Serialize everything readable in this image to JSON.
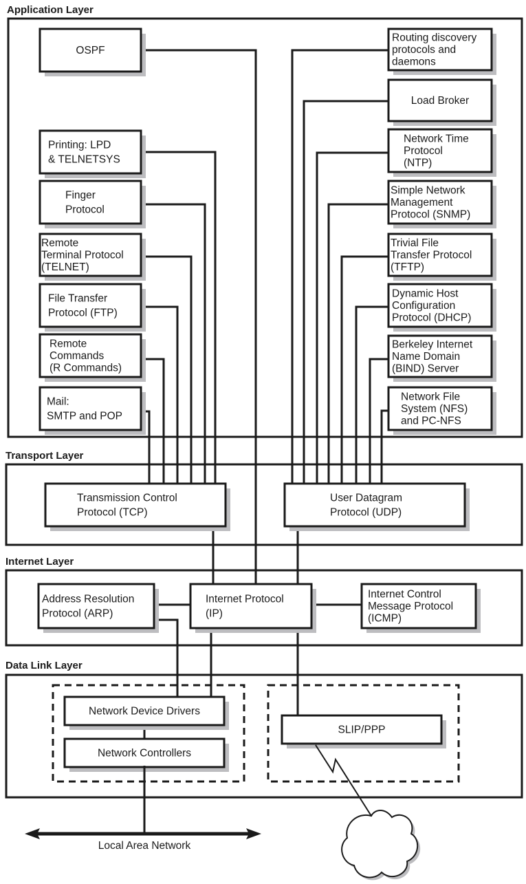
{
  "layers": {
    "application": "Application Layer",
    "transport": "Transport Layer",
    "internet": "Internet Layer",
    "data_link": "Data Link Layer"
  },
  "application_left": [
    {
      "id": "ospf",
      "lines": [
        "OSPF"
      ]
    },
    {
      "id": "printing",
      "lines": [
        "Printing: LPD",
        "& TELNETSYS"
      ]
    },
    {
      "id": "finger",
      "lines": [
        "Finger",
        "Protocol"
      ]
    },
    {
      "id": "telnet",
      "lines": [
        "Remote",
        "Terminal Protocol",
        "(TELNET)"
      ]
    },
    {
      "id": "ftp",
      "lines": [
        "File Transfer",
        "Protocol (FTP)"
      ]
    },
    {
      "id": "rcommands",
      "lines": [
        "Remote",
        "Commands",
        "(R Commands)"
      ]
    },
    {
      "id": "mail",
      "lines": [
        "Mail:",
        "SMTP and POP"
      ]
    }
  ],
  "application_right": [
    {
      "id": "routing",
      "lines": [
        "Routing discovery",
        "protocols and",
        "daemons"
      ]
    },
    {
      "id": "loadbroker",
      "lines": [
        "Load Broker"
      ]
    },
    {
      "id": "ntp",
      "lines": [
        "Network Time",
        "Protocol",
        "(NTP)"
      ]
    },
    {
      "id": "snmp",
      "lines": [
        "Simple Network",
        "Management",
        "Protocol (SNMP)"
      ]
    },
    {
      "id": "tftp",
      "lines": [
        "Trivial File",
        "Transfer Protocol",
        "(TFTP)"
      ]
    },
    {
      "id": "dhcp",
      "lines": [
        "Dynamic Host",
        "Configuration",
        "Protocol (DHCP)"
      ]
    },
    {
      "id": "bind",
      "lines": [
        "Berkeley Internet",
        "Name Domain",
        "(BIND) Server"
      ]
    },
    {
      "id": "nfs",
      "lines": [
        "Network File",
        "System (NFS)",
        "and PC-NFS"
      ]
    }
  ],
  "transport": [
    {
      "id": "tcp",
      "lines": [
        "Transmission Control",
        "Protocol (TCP)"
      ]
    },
    {
      "id": "udp",
      "lines": [
        "User Datagram",
        "Protocol (UDP)"
      ]
    }
  ],
  "internet": [
    {
      "id": "arp",
      "lines": [
        "Address Resolution",
        "Protocol (ARP)"
      ]
    },
    {
      "id": "ip",
      "lines": [
        "Internet Protocol",
        "(IP)"
      ]
    },
    {
      "id": "icmp",
      "lines": [
        "Internet Control",
        "Message Protocol",
        "(ICMP)"
      ]
    }
  ],
  "data_link": [
    {
      "id": "drivers",
      "lines": [
        "Network Device Drivers"
      ]
    },
    {
      "id": "controllers",
      "lines": [
        "Network Controllers"
      ]
    },
    {
      "id": "slip",
      "lines": [
        "SLIP/PPP"
      ]
    }
  ],
  "lan_label": "Local Area Network",
  "icons": {
    "cloud": "cloud-icon",
    "lightning": "serial-link-icon",
    "arrow": "double-arrow-icon"
  },
  "colors": {
    "stroke": "#1a1a1a",
    "shadow": "#bdbdc0",
    "background": "#ffffff"
  }
}
